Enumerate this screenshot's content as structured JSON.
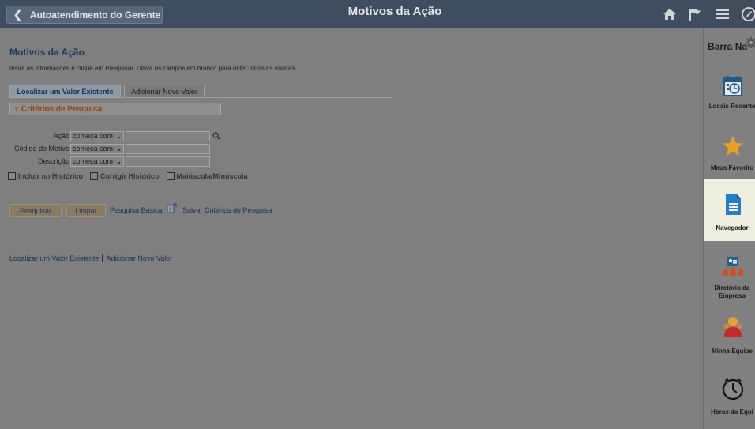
{
  "header": {
    "back_label": "Autoatendimento do Gerente",
    "title": "Motivos da Ação",
    "icons": [
      "home-icon",
      "flag-icon",
      "menu-icon",
      "navbar-compass-icon"
    ]
  },
  "page": {
    "title": "Motivos da Ação",
    "instructions": "Insira as informações e clique em Pesquisar. Deixe os campos em branco para obter todos os valores.",
    "tabs": {
      "active": "Localizar um Valor Existente",
      "inactive": "Adicionar Novo Valor"
    },
    "criteria_header": "Critérios de Pesquisa",
    "fields": [
      {
        "label": "Ação",
        "operator": "começa com",
        "value": ""
      },
      {
        "label": "Código do Motivo",
        "operator": "começa com",
        "value": ""
      },
      {
        "label": "Descrição",
        "operator": "começa com",
        "value": ""
      }
    ],
    "checkboxes": [
      {
        "label": "Incluir no Histórico",
        "checked": false
      },
      {
        "label": "Corrigir Histórico",
        "checked": false
      },
      {
        "label": "Maiúscula/Minúscula",
        "checked": false
      }
    ],
    "buttons": {
      "search": "Pesquisar",
      "clear": "Limpar",
      "basic_search": "Pesquisa Básica",
      "save_criteria": "Salvar Critérios de Pesquisa"
    },
    "bottom_links": {
      "find": "Localizar um Valor Existente",
      "add": "Adicionar Novo Valor"
    }
  },
  "navbar": {
    "title": "Barra Na",
    "items": [
      {
        "label": "Locais Recente",
        "icon": "calendar-clock-icon"
      },
      {
        "label": "Meus Favorito",
        "icon": "star-icon"
      },
      {
        "label": "Navegador",
        "icon": "document-icon"
      },
      {
        "label_line1": "Diretório da",
        "label_line2": "Empresa",
        "icon": "org-chart-icon"
      },
      {
        "label": "Minha Equipe",
        "icon": "team-icon"
      },
      {
        "label": "Horas da Equi",
        "icon": "clock-icon"
      }
    ]
  },
  "colors": {
    "header_bg": "#3f4d5e",
    "overlay_bg": "#7f7f7f",
    "link": "#14305c",
    "criteria_text": "#a04000",
    "active_nav_bg": "#efefdf"
  }
}
